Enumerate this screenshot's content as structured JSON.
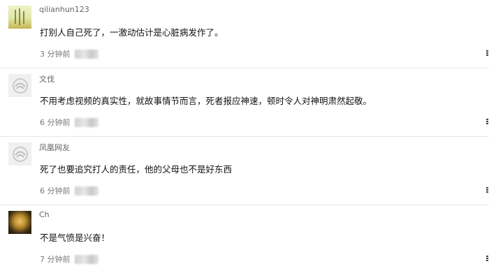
{
  "comments": [
    {
      "user": "qilianhun123",
      "text": "打别人自己死了，一激动估计是心脏病发作了。",
      "time": "3 分钟前",
      "avatar": "landscape-art-avatar"
    },
    {
      "user": "文伐",
      "text": "不用考虑视频的真实性，就故事情节而言，死者报应神速，顿时令人对神明肃然起敬。",
      "time": "6 分钟前",
      "avatar": "default-avatar"
    },
    {
      "user": "凤凰网友",
      "text": "死了也要追究打人的责任，他的父母也不是好东西",
      "time": "6 分钟前",
      "avatar": "default-avatar"
    },
    {
      "user": "Ch",
      "text": "不是气愤是兴奋！",
      "time": "7 分钟前",
      "avatar": "photo-avatar"
    }
  ],
  "colors": {
    "divider": "#e6e6e6",
    "name": "#666666",
    "text": "#111111",
    "meta": "#777777"
  }
}
